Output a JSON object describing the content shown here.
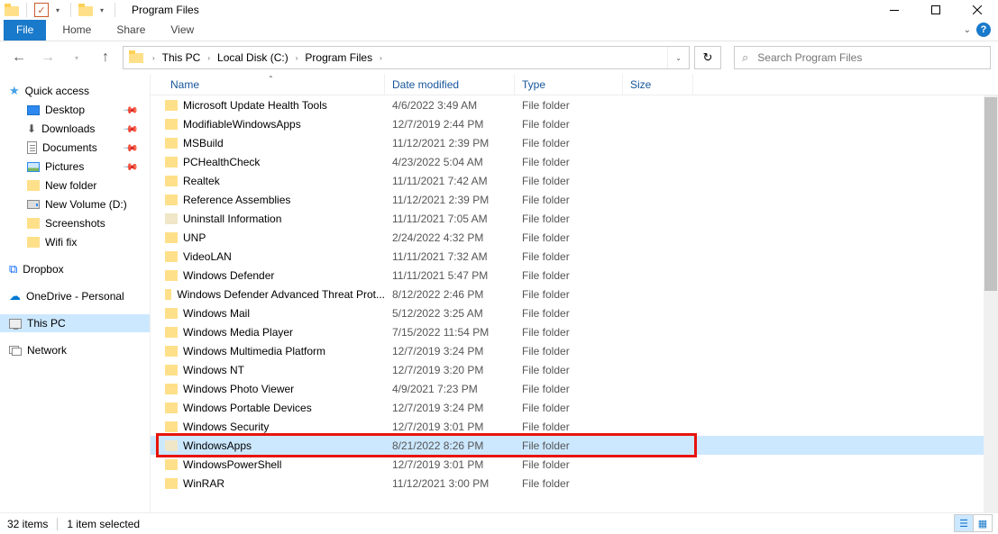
{
  "window": {
    "title": "Program Files"
  },
  "ribbon": {
    "file": "File",
    "tabs": [
      "Home",
      "Share",
      "View"
    ]
  },
  "breadcrumb": [
    "This PC",
    "Local Disk (C:)",
    "Program Files"
  ],
  "search": {
    "placeholder": "Search Program Files"
  },
  "columns": {
    "name": "Name",
    "date": "Date modified",
    "type": "Type",
    "size": "Size"
  },
  "sidebar": {
    "quick_access": "Quick access",
    "desktop": "Desktop",
    "downloads": "Downloads",
    "documents": "Documents",
    "pictures": "Pictures",
    "new_folder": "New folder",
    "new_volume": "New Volume (D:)",
    "screenshots": "Screenshots",
    "wifi_fix": "Wifi fix",
    "dropbox": "Dropbox",
    "onedrive": "OneDrive - Personal",
    "this_pc": "This PC",
    "network": "Network"
  },
  "file_type": "File folder",
  "rows": [
    {
      "name": "Microsoft Update Health Tools",
      "date": "4/6/2022 3:49 AM"
    },
    {
      "name": "ModifiableWindowsApps",
      "date": "12/7/2019 2:44 PM"
    },
    {
      "name": "MSBuild",
      "date": "11/12/2021 2:39 PM"
    },
    {
      "name": "PCHealthCheck",
      "date": "4/23/2022 5:04 AM"
    },
    {
      "name": "Realtek",
      "date": "11/11/2021 7:42 AM"
    },
    {
      "name": "Reference Assemblies",
      "date": "11/12/2021 2:39 PM"
    },
    {
      "name": "Uninstall Information",
      "date": "11/11/2021 7:05 AM",
      "dim": true
    },
    {
      "name": "UNP",
      "date": "2/24/2022 4:32 PM"
    },
    {
      "name": "VideoLAN",
      "date": "11/11/2021 7:32 AM"
    },
    {
      "name": "Windows Defender",
      "date": "11/11/2021 5:47 PM"
    },
    {
      "name": "Windows Defender Advanced Threat Prot...",
      "date": "8/12/2022 2:46 PM"
    },
    {
      "name": "Windows Mail",
      "date": "5/12/2022 3:25 AM"
    },
    {
      "name": "Windows Media Player",
      "date": "7/15/2022 11:54 PM"
    },
    {
      "name": "Windows Multimedia Platform",
      "date": "12/7/2019 3:24 PM"
    },
    {
      "name": "Windows NT",
      "date": "12/7/2019 3:20 PM"
    },
    {
      "name": "Windows Photo Viewer",
      "date": "4/9/2021 7:23 PM"
    },
    {
      "name": "Windows Portable Devices",
      "date": "12/7/2019 3:24 PM"
    },
    {
      "name": "Windows Security",
      "date": "12/7/2019 3:01 PM"
    },
    {
      "name": "WindowsApps",
      "date": "8/21/2022 8:26 PM",
      "selected": true,
      "dim": true
    },
    {
      "name": "WindowsPowerShell",
      "date": "12/7/2019 3:01 PM"
    },
    {
      "name": "WinRAR",
      "date": "11/12/2021 3:00 PM"
    }
  ],
  "status": {
    "items": "32 items",
    "selected": "1 item selected"
  }
}
